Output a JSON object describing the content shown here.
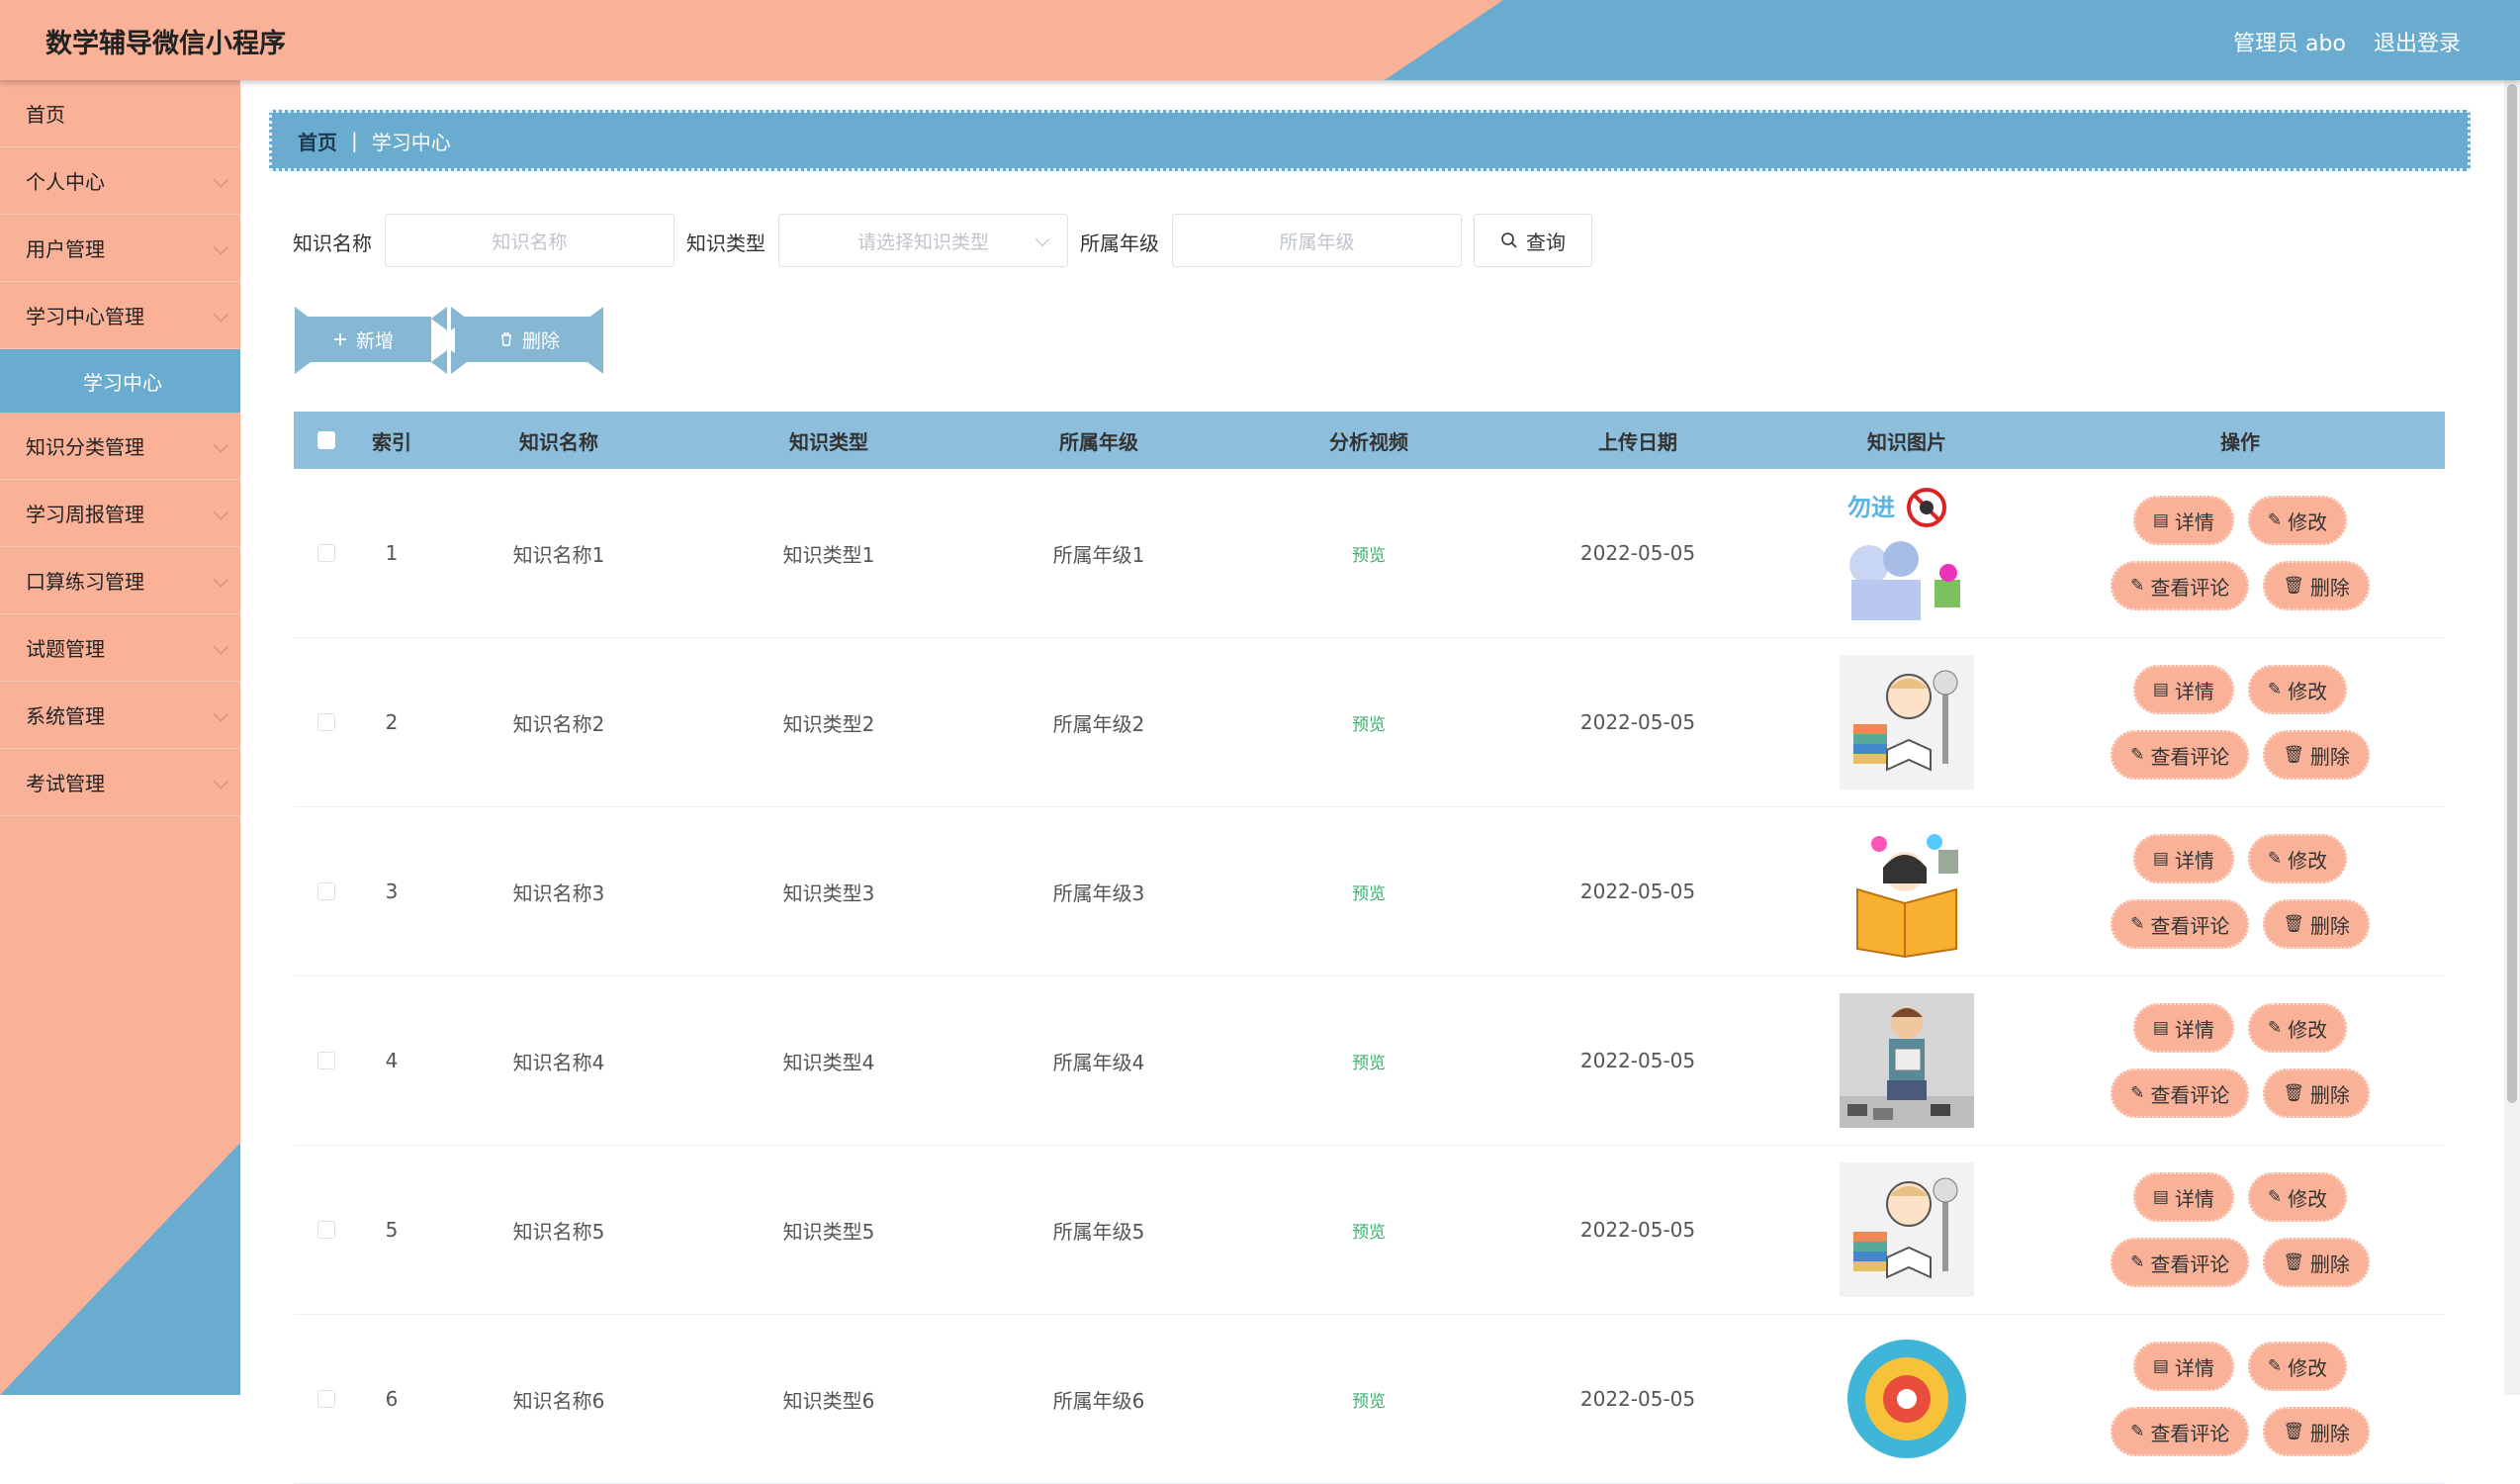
{
  "header": {
    "title": "数学辅导微信小程序",
    "admin": "管理员 abo",
    "logout": "退出登录"
  },
  "sidebar": {
    "items": [
      {
        "label": "首页",
        "has_arrow": false
      },
      {
        "label": "个人中心",
        "has_arrow": true
      },
      {
        "label": "用户管理",
        "has_arrow": true
      },
      {
        "label": "学习中心管理",
        "has_arrow": true
      },
      {
        "label": "知识分类管理",
        "has_arrow": true
      },
      {
        "label": "学习周报管理",
        "has_arrow": true
      },
      {
        "label": "口算练习管理",
        "has_arrow": true
      },
      {
        "label": "试题管理",
        "has_arrow": true
      },
      {
        "label": "系统管理",
        "has_arrow": true
      },
      {
        "label": "考试管理",
        "has_arrow": true
      }
    ],
    "active_sub": "学习中心"
  },
  "breadcrumb": {
    "home": "首页",
    "current": "学习中心"
  },
  "search": {
    "name_label": "知识名称",
    "name_placeholder": "知识名称",
    "type_label": "知识类型",
    "type_placeholder": "请选择知识类型",
    "grade_label": "所属年级",
    "grade_placeholder": "所属年级",
    "query_label": "查询"
  },
  "actions": {
    "add_label": "新增",
    "delete_label": "删除"
  },
  "table": {
    "headers": [
      "索引",
      "知识名称",
      "知识类型",
      "所属年级",
      "分析视频",
      "上传日期",
      "知识图片",
      "操作"
    ],
    "rows": [
      {
        "index": "1",
        "name": "知识名称1",
        "type": "知识类型1",
        "grade": "所属年级1",
        "video": "预览",
        "date": "2022-05-05",
        "image": "cartoon-warning"
      },
      {
        "index": "2",
        "name": "知识名称2",
        "type": "知识类型2",
        "grade": "所属年级2",
        "video": "预览",
        "date": "2022-05-05",
        "image": "cartoon-student-reading"
      },
      {
        "index": "3",
        "name": "知识名称3",
        "type": "知识类型3",
        "grade": "所属年级3",
        "video": "预览",
        "date": "2022-05-05",
        "image": "cartoon-girl-book"
      },
      {
        "index": "4",
        "name": "知识名称4",
        "type": "知识类型4",
        "grade": "所属年级4",
        "video": "预览",
        "date": "2022-05-05",
        "image": "cartoon-man-reading"
      },
      {
        "index": "5",
        "name": "知识名称5",
        "type": "知识类型5",
        "grade": "所属年级5",
        "video": "预览",
        "date": "2022-05-05",
        "image": "cartoon-student-reading"
      },
      {
        "index": "6",
        "name": "知识名称6",
        "type": "知识类型6",
        "grade": "所属年级6",
        "video": "预览",
        "date": "2022-05-05",
        "image": "chart-circle"
      }
    ],
    "ops": {
      "detail": "详情",
      "edit": "修改",
      "comments": "查看评论",
      "delete": "删除"
    }
  },
  "colors": {
    "salmon": "#f9b198",
    "blue": "#6aabd0",
    "header_blue": "#8dbedb",
    "preview_green": "#39b06d"
  }
}
